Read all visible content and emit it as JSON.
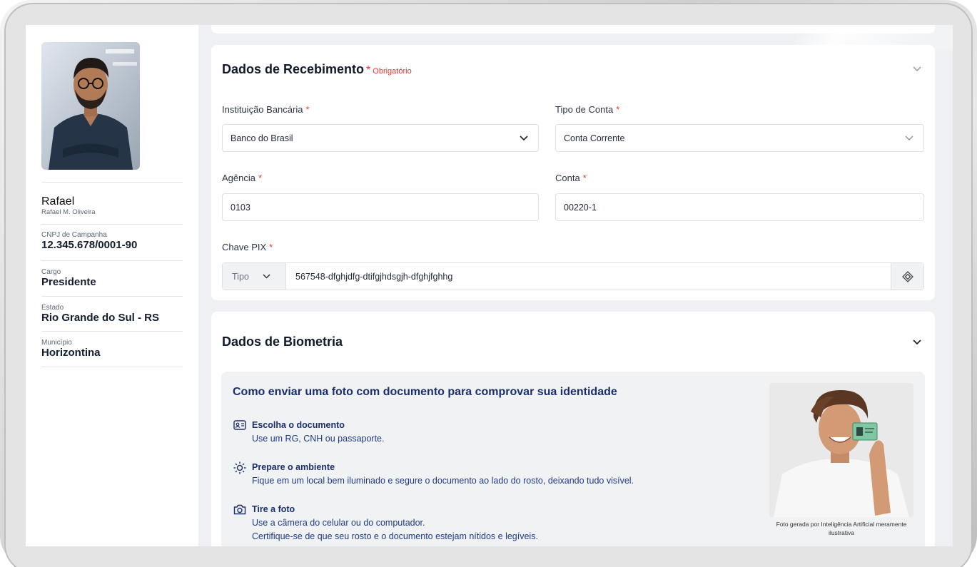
{
  "profile": {
    "name": "Rafael",
    "full_name": "Rafael M. Oliveira",
    "cnpj_label": "CNPJ de Campanha",
    "cnpj_value": "12.345.678/0001-90",
    "cargo_label": "Cargo",
    "cargo_value": "Presidente",
    "estado_label": "Estado",
    "estado_value": "Rio Grande do Sul - RS",
    "municipio_label": "Município",
    "municipio_value": "Horizontina"
  },
  "recebimento": {
    "title": "Dados de Recebimento",
    "required_star": "*",
    "required_text": "Obrigatório",
    "banco_label": "Instituição Bancária",
    "banco_value": "Banco do Brasil",
    "tipo_conta_label": "Tipo de Conta",
    "tipo_conta_value": "Conta Corrente",
    "agencia_label": "Agência",
    "agencia_value": "0103",
    "conta_label": "Conta",
    "conta_value": "00220-1",
    "pix_label": "Chave PIX",
    "pix_type_placeholder": "Tipo",
    "pix_value": "567548-dfghjdfg-dtifgjhdsgjh-dfghjfghhg",
    "star": "*"
  },
  "biometria": {
    "title": "Dados de Biometria",
    "heading": "Como enviar uma foto com documento para comprovar sua identidade",
    "steps": [
      {
        "icon": "id-card-icon",
        "title": "Escolha o documento",
        "text": "Use um RG, CNH ou passaporte."
      },
      {
        "icon": "sun-icon",
        "title": "Prepare o ambiente",
        "text": "Fique em um local bem iluminado e segure o documento ao lado do rosto, deixando tudo visível."
      },
      {
        "icon": "camera-icon",
        "title": "Tire a foto",
        "text": "Use a câmera do celular ou do computador.",
        "text2": "Certifique-se de que seu rosto e o documento estejam nítidos e legíveis."
      }
    ],
    "photo_caption": "Foto gerada por Inteligência Artificial meramente ilustrativa"
  },
  "colors": {
    "accent": "#1a2f6e",
    "required": "#e53935",
    "background": "#eef0f3"
  }
}
